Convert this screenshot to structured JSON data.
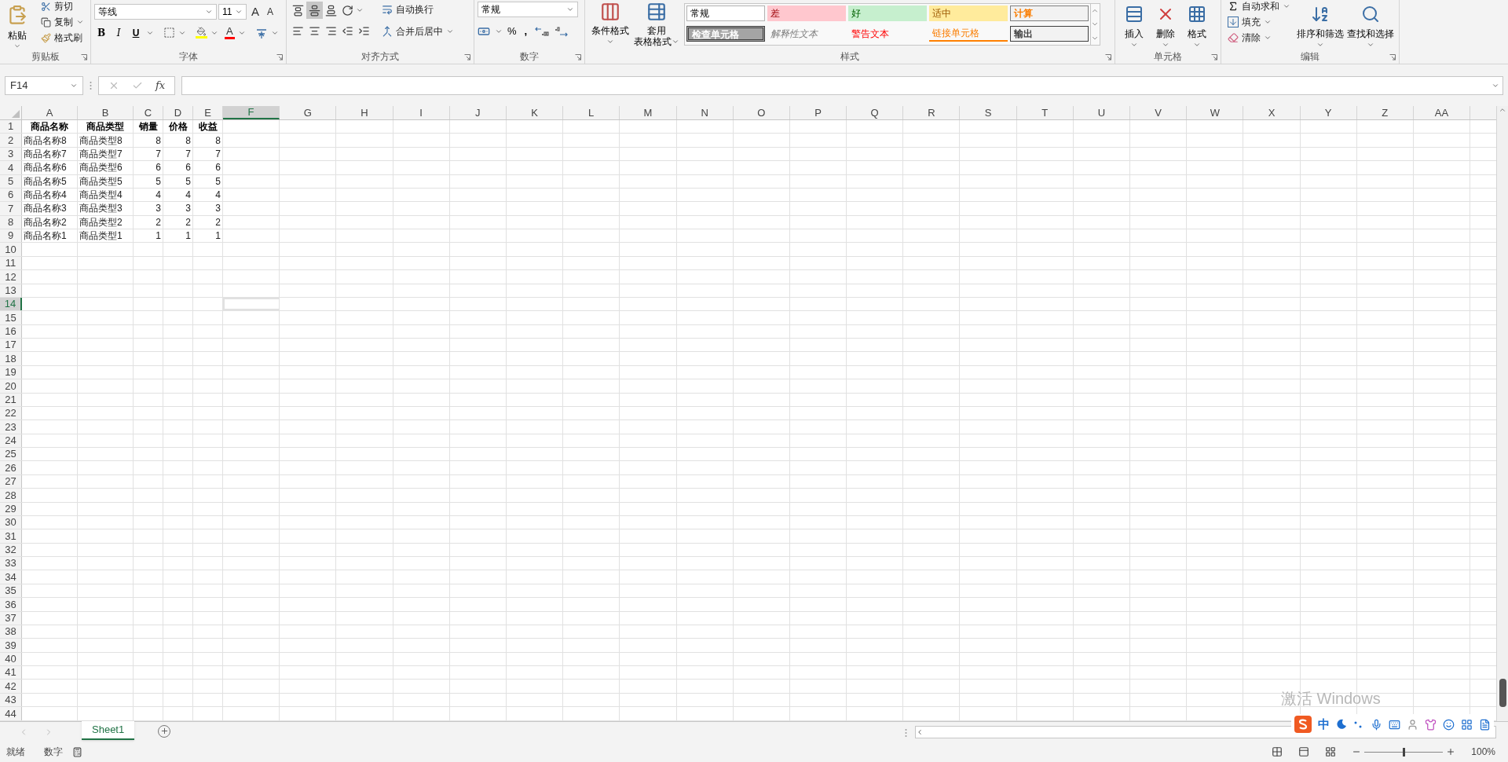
{
  "ribbon": {
    "clipboard": {
      "paste": "粘贴",
      "cut": "剪切",
      "copy": "复制",
      "format_painter": "格式刷",
      "label": "剪贴板"
    },
    "font": {
      "name": "等线",
      "size": "11",
      "grow": "A",
      "shrink": "A",
      "bold": "B",
      "italic": "I",
      "underline": "U",
      "font_color": "A",
      "label": "字体"
    },
    "alignment": {
      "wrap": "自动换行",
      "merge": "合并后居中",
      "label": "对齐方式"
    },
    "number": {
      "format": "常规",
      "percent": "%",
      "comma": ",",
      "label": "数字"
    },
    "styles": {
      "conditional": "条件格式",
      "table_format": [
        "套用",
        "表格格式"
      ],
      "label": "样式",
      "cells": [
        {
          "label": "常规",
          "kind": "normal"
        },
        {
          "label": "差",
          "kind": "bad"
        },
        {
          "label": "好",
          "kind": "good"
        },
        {
          "label": "适中",
          "kind": "neutral"
        },
        {
          "label": "计算",
          "kind": "calc"
        },
        {
          "label": "检查单元格",
          "kind": "check"
        },
        {
          "label": "解释性文本",
          "kind": "explain"
        },
        {
          "label": "警告文本",
          "kind": "warning"
        },
        {
          "label": "链接单元格",
          "kind": "linked"
        },
        {
          "label": "输出",
          "kind": "output"
        }
      ]
    },
    "cells": {
      "insert": "插入",
      "delete": "删除",
      "format": "格式",
      "label": "单元格"
    },
    "editing": {
      "autosum": "自动求和",
      "fill": "填充",
      "clear": "清除",
      "sort": "排序和筛选",
      "find": "查找和选择",
      "label": "编辑"
    }
  },
  "formula_bar": {
    "name_box": "F14",
    "fx": "fx"
  },
  "sheet": {
    "columns": [
      {
        "label": "A",
        "selected": false
      },
      {
        "label": "B",
        "selected": false
      },
      {
        "label": "C",
        "selected": false
      },
      {
        "label": "D",
        "selected": false
      },
      {
        "label": "E",
        "selected": false
      },
      {
        "label": "F",
        "selected": true
      },
      {
        "label": "G",
        "selected": false
      },
      {
        "label": "H",
        "selected": false
      },
      {
        "label": "I",
        "selected": false
      },
      {
        "label": "J",
        "selected": false
      },
      {
        "label": "K",
        "selected": false
      },
      {
        "label": "L",
        "selected": false
      },
      {
        "label": "M",
        "selected": false
      },
      {
        "label": "N",
        "selected": false
      },
      {
        "label": "O",
        "selected": false
      },
      {
        "label": "P",
        "selected": false
      },
      {
        "label": "Q",
        "selected": false
      },
      {
        "label": "R",
        "selected": false
      },
      {
        "label": "S",
        "selected": false
      },
      {
        "label": "T",
        "selected": false
      },
      {
        "label": "U",
        "selected": false
      },
      {
        "label": "V",
        "selected": false
      },
      {
        "label": "W",
        "selected": false
      },
      {
        "label": "X",
        "selected": false
      },
      {
        "label": "Y",
        "selected": false
      },
      {
        "label": "Z",
        "selected": false
      },
      {
        "label": "AA",
        "selected": false
      }
    ],
    "rows": [
      {
        "label": "1",
        "selected": false
      },
      {
        "label": "2",
        "selected": false
      },
      {
        "label": "3",
        "selected": false
      },
      {
        "label": "4",
        "selected": false
      },
      {
        "label": "5",
        "selected": false
      },
      {
        "label": "6",
        "selected": false
      },
      {
        "label": "7",
        "selected": false
      },
      {
        "label": "8",
        "selected": false
      },
      {
        "label": "9",
        "selected": false
      },
      {
        "label": "10",
        "selected": false
      },
      {
        "label": "11",
        "selected": false
      },
      {
        "label": "12",
        "selected": false
      },
      {
        "label": "13",
        "selected": false
      },
      {
        "label": "14",
        "selected": true
      },
      {
        "label": "15",
        "selected": false
      },
      {
        "label": "16",
        "selected": false
      },
      {
        "label": "17",
        "selected": false
      },
      {
        "label": "18",
        "selected": false
      },
      {
        "label": "19",
        "selected": false
      },
      {
        "label": "20",
        "selected": false
      },
      {
        "label": "21",
        "selected": false
      },
      {
        "label": "22",
        "selected": false
      },
      {
        "label": "23",
        "selected": false
      },
      {
        "label": "24",
        "selected": false
      },
      {
        "label": "25",
        "selected": false
      },
      {
        "label": "26",
        "selected": false
      },
      {
        "label": "27",
        "selected": false
      },
      {
        "label": "28",
        "selected": false
      },
      {
        "label": "29",
        "selected": false
      },
      {
        "label": "30",
        "selected": false
      },
      {
        "label": "31",
        "selected": false
      },
      {
        "label": "32",
        "selected": false
      },
      {
        "label": "33",
        "selected": false
      },
      {
        "label": "34",
        "selected": false
      },
      {
        "label": "35",
        "selected": false
      },
      {
        "label": "36",
        "selected": false
      },
      {
        "label": "37",
        "selected": false
      },
      {
        "label": "38",
        "selected": false
      },
      {
        "label": "39",
        "selected": false
      },
      {
        "label": "40",
        "selected": false
      },
      {
        "label": "41",
        "selected": false
      },
      {
        "label": "42",
        "selected": false
      },
      {
        "label": "43",
        "selected": false
      },
      {
        "label": "44",
        "selected": false
      }
    ],
    "header": [
      "商品名称",
      "商品类型",
      "销量",
      "价格",
      "收益"
    ],
    "data": [
      [
        "商品名称8",
        "商品类型8",
        "8",
        "8",
        "8"
      ],
      [
        "商品名称7",
        "商品类型7",
        "7",
        "7",
        "7"
      ],
      [
        "商品名称6",
        "商品类型6",
        "6",
        "6",
        "6"
      ],
      [
        "商品名称5",
        "商品类型5",
        "5",
        "5",
        "5"
      ],
      [
        "商品名称4",
        "商品类型4",
        "4",
        "4",
        "4"
      ],
      [
        "商品名称3",
        "商品类型3",
        "3",
        "3",
        "3"
      ],
      [
        "商品名称2",
        "商品类型2",
        "2",
        "2",
        "2"
      ],
      [
        "商品名称1",
        "商品类型1",
        "1",
        "1",
        "1"
      ]
    ]
  },
  "sheet_tabs": [
    {
      "label": "Sheet1",
      "selected": true
    }
  ],
  "status_bar": {
    "ready": "就绪",
    "mode": "数字",
    "zoom": "100%",
    "zoom_slider": {
      "level": 0.5
    }
  },
  "activation_notice": "激活 Windows",
  "ime_toolbar": {
    "mode": "中"
  }
}
